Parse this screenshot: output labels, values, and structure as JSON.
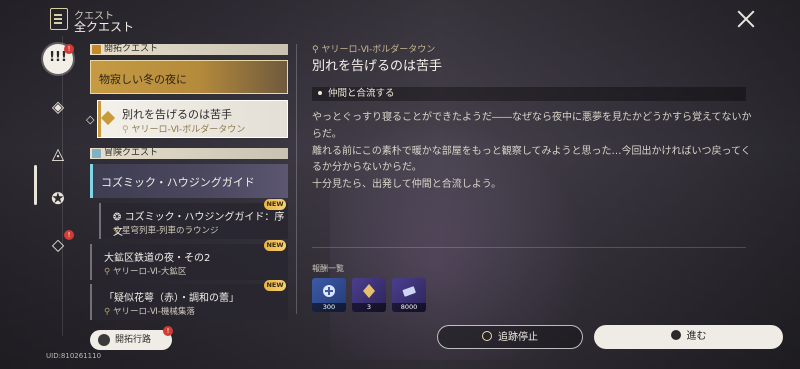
{
  "header": {
    "subtitle": "クエスト",
    "title": "全クエスト"
  },
  "rail": {
    "badge": "!"
  },
  "list": {
    "section1": "開拓クエスト",
    "section2": "冒険クエスト",
    "quests": [
      {
        "title": "物寂しい冬の夜に"
      },
      {
        "title": "別れを告げるのは苦手",
        "location": "ヤリーロ-Ⅵ-ボルダータウン"
      },
      {
        "title": "コズミック・ハウジングガイド"
      },
      {
        "title": "コズミック・ハウジングガイド：序文",
        "location": "星穹列車-列車のラウンジ",
        "badge": "NEW"
      },
      {
        "title": "大鉱区鉄道の夜・その2",
        "location": "ヤリーロ-Ⅵ-大鉱区",
        "badge": "NEW"
      },
      {
        "title": "「疑似花萼（赤）・調和の蕾」",
        "location": "ヤリーロ-Ⅵ-機械集落",
        "badge": "NEW"
      }
    ]
  },
  "route_button": "開拓行路",
  "uid": "UID:810261110",
  "detail": {
    "location": "ヤリーロ-Ⅵ-ボルダータウン",
    "title": "別れを告げるのは苦手",
    "objective": "仲間と合流する",
    "description": "やっとぐっすり寝ることができたようだ――なぜなら夜中に悪夢を見たかどうかすら覚えてないからだ。\n離れる前にこの素朴で暖かな部屋をもっと観察してみようと思った…今回出かければいつ戻ってくるか分からないからだ。\n十分見たら、出発して仲間と合流しよう。",
    "rewards_label": "報酬一覧",
    "rewards": [
      {
        "count": "300"
      },
      {
        "count": "3"
      },
      {
        "count": "8000"
      }
    ]
  },
  "buttons": {
    "stop": "追跡停止",
    "go": "進む"
  }
}
